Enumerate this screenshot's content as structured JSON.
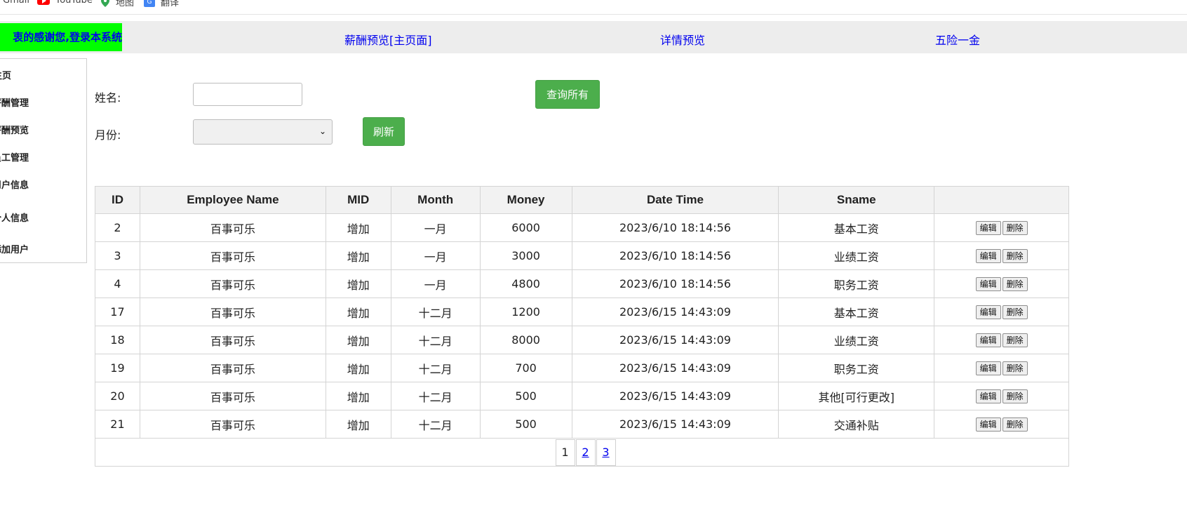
{
  "bookmarks": [
    {
      "label": "Gmail",
      "icon": "gmail-icon"
    },
    {
      "label": "YouTube",
      "icon": "youtube-icon"
    },
    {
      "label": "地图",
      "icon": "maps-icon"
    },
    {
      "label": "翻译",
      "icon": "translate-icon"
    }
  ],
  "topnav": {
    "welcome": "衷的感谢您,登录本系统",
    "links": [
      "薪酬预览[主页面]",
      "详情预览",
      "五险一金"
    ]
  },
  "sidebar": {
    "items": [
      "主页",
      "薪酬管理",
      "薪酬预览",
      "员工管理",
      "用户信息",
      "个人信息",
      "添加用户"
    ]
  },
  "form": {
    "name_label": "姓名:",
    "name_value": "",
    "month_label": "月份:",
    "month_value": "",
    "query_all": "查询所有",
    "refresh": "刷新"
  },
  "table": {
    "headers": [
      "ID",
      "Employee Name",
      "MID",
      "Month",
      "Money",
      "Date Time",
      "Sname",
      ""
    ],
    "rows": [
      [
        "2",
        "百事可乐",
        "增加",
        "一月",
        "6000",
        "2023/6/10 18:14:56",
        "基本工资"
      ],
      [
        "3",
        "百事可乐",
        "增加",
        "一月",
        "3000",
        "2023/6/10 18:14:56",
        "业绩工资"
      ],
      [
        "4",
        "百事可乐",
        "增加",
        "一月",
        "4800",
        "2023/6/10 18:14:56",
        "职务工资"
      ],
      [
        "17",
        "百事可乐",
        "增加",
        "十二月",
        "1200",
        "2023/6/15 14:43:09",
        "基本工资"
      ],
      [
        "18",
        "百事可乐",
        "增加",
        "十二月",
        "8000",
        "2023/6/15 14:43:09",
        "业绩工资"
      ],
      [
        "19",
        "百事可乐",
        "增加",
        "十二月",
        "700",
        "2023/6/15 14:43:09",
        "职务工资"
      ],
      [
        "20",
        "百事可乐",
        "增加",
        "十二月",
        "500",
        "2023/6/15 14:43:09",
        "其他[可行更改]"
      ],
      [
        "21",
        "百事可乐",
        "增加",
        "十二月",
        "500",
        "2023/6/15 14:43:09",
        "交通补贴"
      ]
    ],
    "edit_label": "编辑",
    "delete_label": "删除"
  },
  "pager": {
    "pages": [
      "1",
      "2",
      "3"
    ],
    "current": "1"
  }
}
